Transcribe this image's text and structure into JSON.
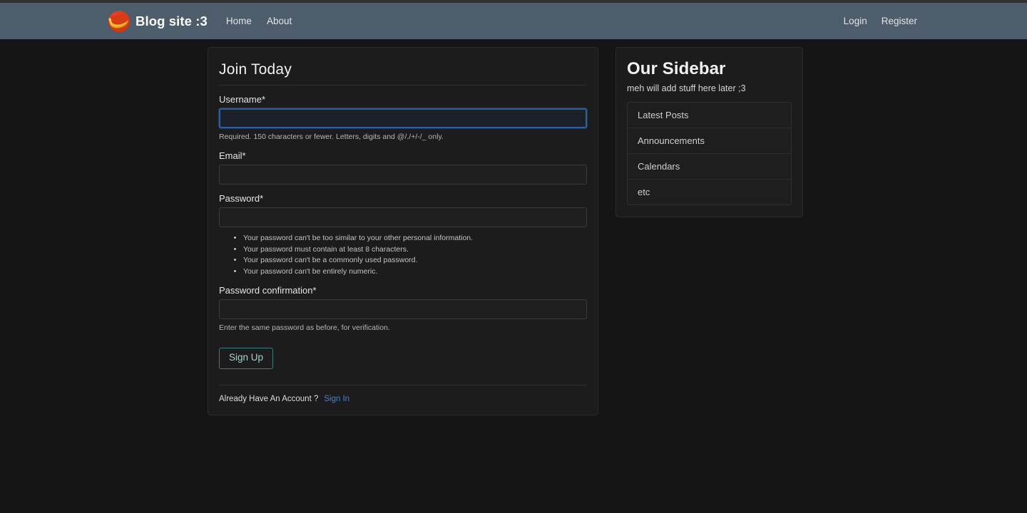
{
  "navbar": {
    "brand": {
      "text": "Blog site :3",
      "logo_icon": "banana-circle-logo-icon"
    },
    "left_links": [
      {
        "label": "Home",
        "name": "nav-link-home"
      },
      {
        "label": "About",
        "name": "nav-link-about"
      }
    ],
    "right_links": [
      {
        "label": "Login",
        "name": "nav-link-login"
      },
      {
        "label": "Register",
        "name": "nav-link-register"
      }
    ],
    "background_color": "#4e5d6c"
  },
  "main": {
    "title": "Join Today",
    "fields": [
      {
        "label": "Username*",
        "value": "",
        "placeholder": "",
        "help": "Required. 150 characters or fewer. Letters, digits and @/./+/-/_ only.",
        "focused": true,
        "type": "text"
      },
      {
        "label": "Email*",
        "value": "",
        "placeholder": "",
        "help": "",
        "focused": false,
        "type": "email"
      },
      {
        "label": "Password*",
        "value": "",
        "placeholder": "",
        "help": "",
        "focused": false,
        "type": "password"
      },
      {
        "label": "Password confirmation*",
        "value": "",
        "placeholder": "",
        "help": "Enter the same password as before, for verification.",
        "focused": false,
        "type": "password"
      }
    ],
    "password_rules": [
      "Your password can't be too similar to your other personal information.",
      "Your password must contain at least 8 characters.",
      "Your password can't be a commonly used password.",
      "Your password can't be entirely numeric."
    ],
    "submit_label": "Sign Up",
    "footer": {
      "prompt": "Already Have An Account ?",
      "link_label": "Sign In"
    }
  },
  "sidebar": {
    "title": "Our Sidebar",
    "subtitle": "meh will add stuff here later ;3",
    "items": [
      {
        "label": "Latest Posts"
      },
      {
        "label": "Announcements"
      },
      {
        "label": "Calendars"
      },
      {
        "label": "etc"
      }
    ]
  },
  "colors": {
    "navbar": "#4e5d6c",
    "page_background": "#151515",
    "card_background": "#1c1c1c",
    "focus_border": "#2d5f9e",
    "signup_border": "#3f7d7a",
    "link_blue": "#4a82c4",
    "logo_red": "#d63a14",
    "logo_yellow": "#f6b81f"
  }
}
